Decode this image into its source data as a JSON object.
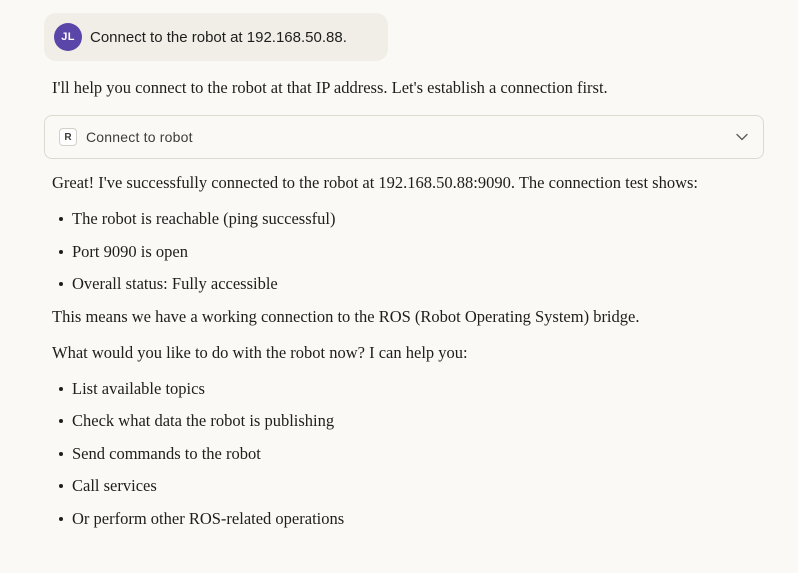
{
  "user_message": {
    "avatar_initials": "JL",
    "text": "Connect to the robot at 192.168.50.88."
  },
  "assistant": {
    "intro": "I'll help you connect to the robot at that IP address. Let's establish a connection first.",
    "tool_call": {
      "badge": "R",
      "label": "Connect to robot",
      "icon": "chevron-down-icon"
    },
    "success_paragraph": "Great! I've successfully connected to the robot at 192.168.50.88:9090. The connection test shows:",
    "status_items": [
      "The robot is reachable (ping successful)",
      "Port 9090 is open",
      "Overall status: Fully accessible"
    ],
    "meaning_paragraph": "This means we have a working connection to the ROS (Robot Operating System) bridge.",
    "question_paragraph": "What would you like to do with the robot now? I can help you:",
    "option_items": [
      "List available topics",
      "Check what data the robot is publishing",
      "Send commands to the robot",
      "Call services",
      "Or perform other ROS-related operations"
    ]
  },
  "colors": {
    "background": "#faf9f5",
    "user_bubble": "#f0eee6",
    "avatar": "#5a45a8",
    "text": "#1f1e1d"
  }
}
